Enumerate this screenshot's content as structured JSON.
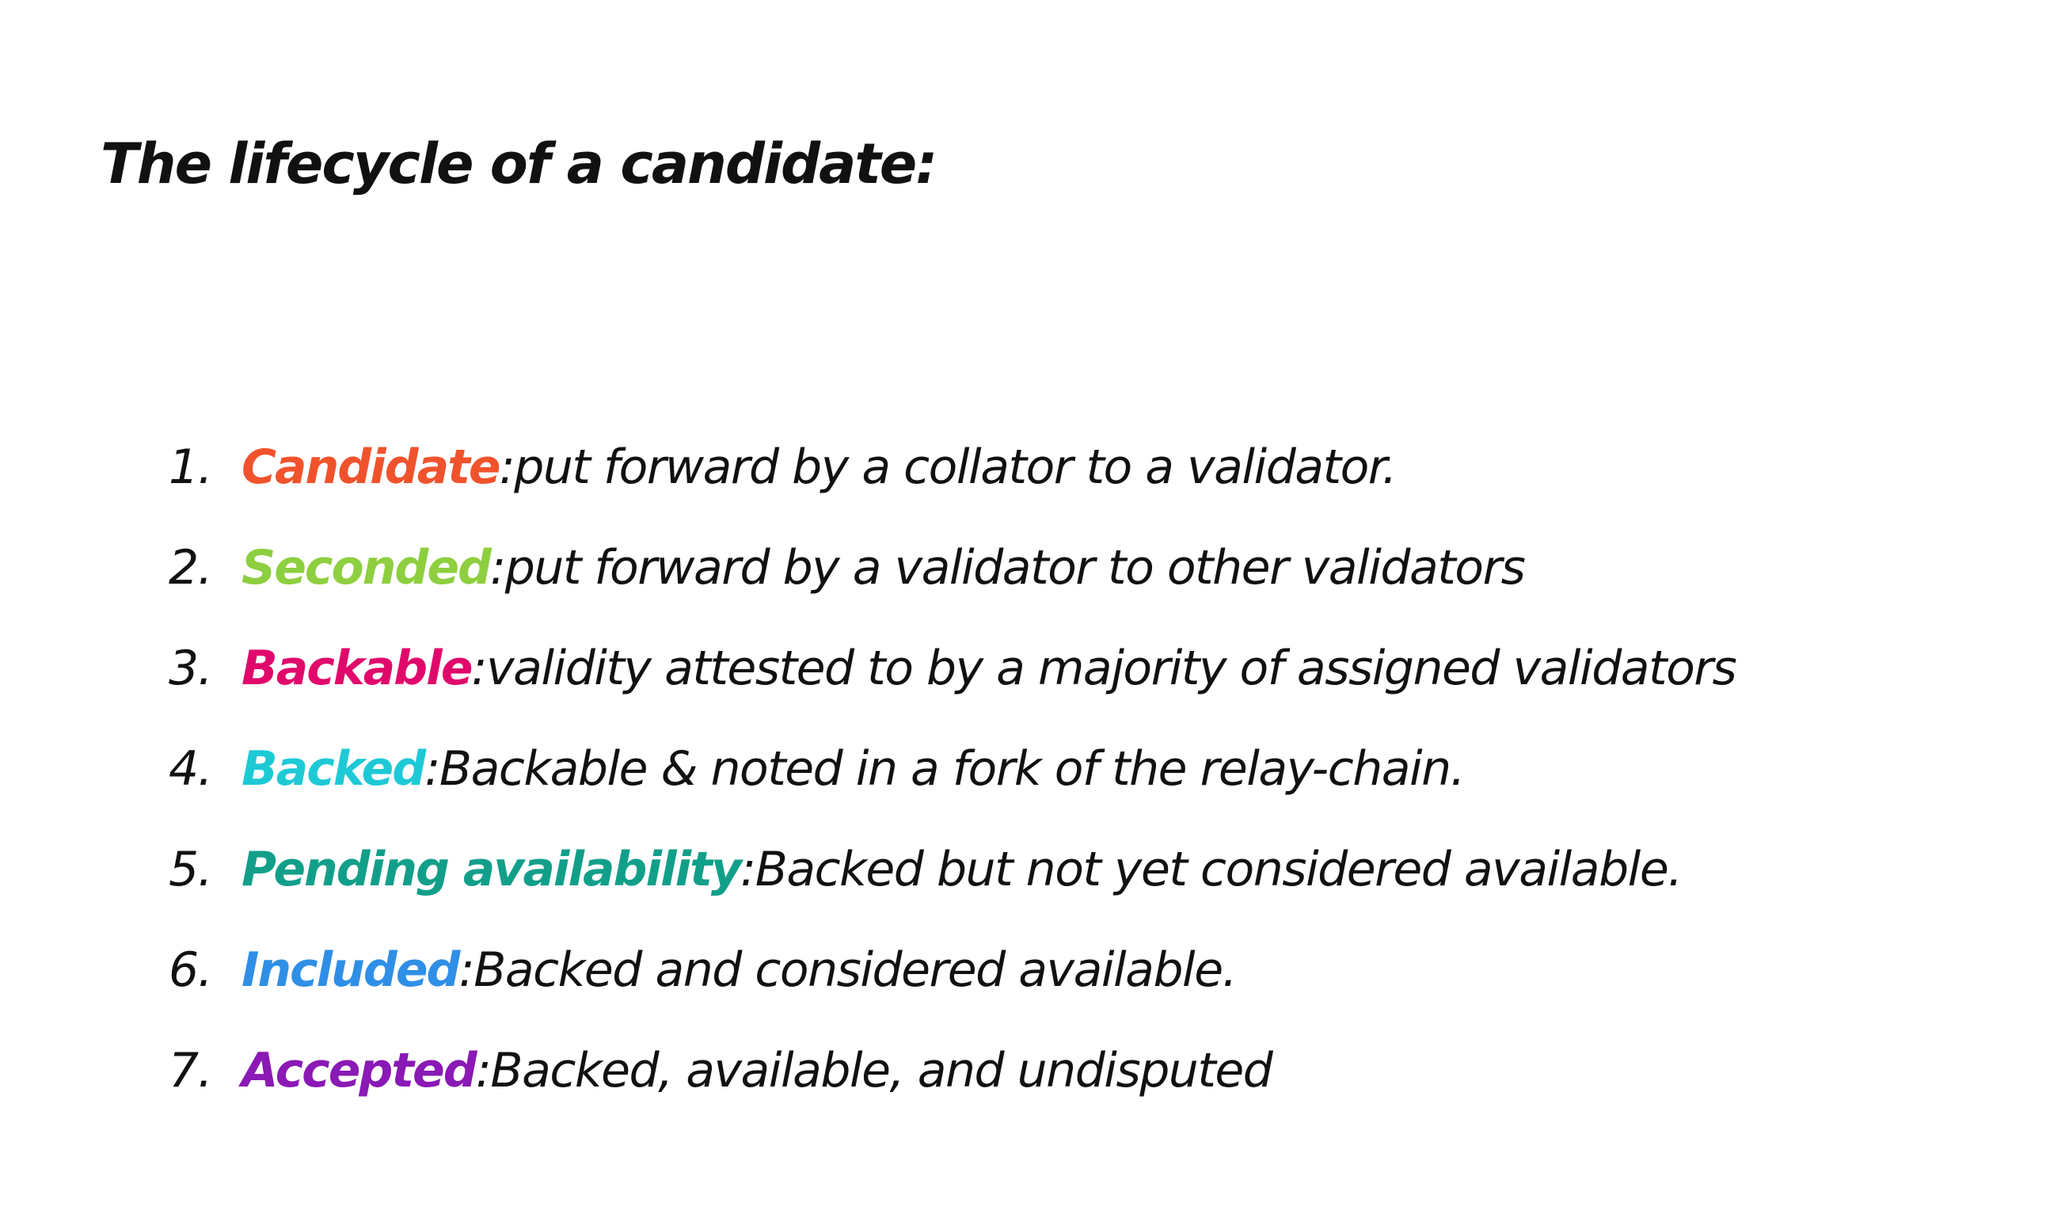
{
  "heading": "The lifecycle of a candidate:",
  "items": [
    {
      "number": "1.",
      "term": "Candidate",
      "separator": ":",
      "description": " put forward by a collator to a validator.",
      "color": "#f0532c"
    },
    {
      "number": "2.",
      "term": "Seconded",
      "separator": ":",
      "description": " put forward by a validator to other validators",
      "color": "#8dcf3f"
    },
    {
      "number": "3.",
      "term": "Backable",
      "separator": ":",
      "description": " validity attested to by a majority of assigned validators",
      "color": "#e0096b"
    },
    {
      "number": "4.",
      "term": "Backed",
      "separator": ":",
      "description": " Backable & noted in a fork of the relay-chain.",
      "color": "#1ec9d6"
    },
    {
      "number": "5.",
      "term": "Pending availability",
      "separator": ":",
      "description": " Backed but not yet considered available.",
      "color": "#129f8a"
    },
    {
      "number": "6.",
      "term": "Included",
      "separator": ":",
      "description": " Backed and considered available.",
      "color": "#2f8fe6"
    },
    {
      "number": "7.",
      "term": "Accepted",
      "separator": ":",
      "description": " Backed, available, and undisputed",
      "color": "#8a19b5"
    }
  ]
}
